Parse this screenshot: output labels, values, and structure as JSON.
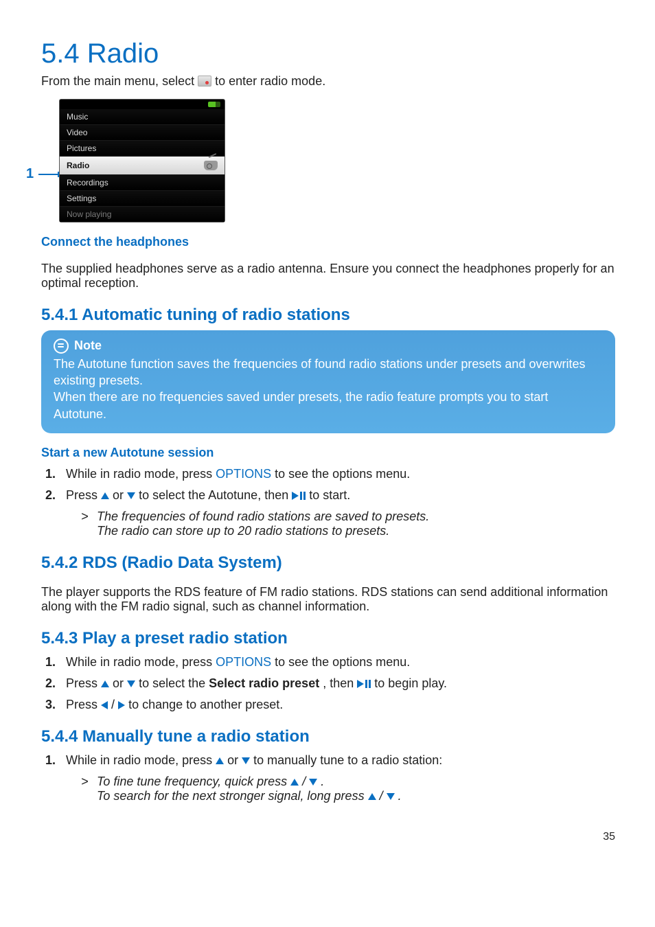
{
  "title": "5.4  Radio",
  "intro_before": "From the main menu, select ",
  "intro_after": " to enter radio mode.",
  "device": {
    "items": [
      "Music",
      "Video",
      "Pictures",
      "Radio",
      "Recordings",
      "Settings",
      "Now playing"
    ],
    "selected_index": 3,
    "callout_number": "1"
  },
  "h_connect": "Connect the headphones",
  "p_connect": "The supplied headphones serve as a radio antenna. Ensure you connect the headphones properly for an optimal reception.",
  "s541": {
    "heading": "5.4.1 Automatic tuning of radio stations",
    "note_label": "Note",
    "note_body1": "The Autotune function saves the frequencies of found radio stations under presets and overwrites existing presets.",
    "note_body2": "When there are no frequencies saved under presets, the radio feature prompts you to start Autotune.",
    "start_heading": "Start a new Autotune session",
    "step1_a": "While in radio mode, press ",
    "step1_options": "OPTIONS",
    "step1_b": " to see the options menu.",
    "step2_a": "Press ",
    "step2_b": " or ",
    "step2_c": " to select the Autotune, then ",
    "step2_d": " to start.",
    "result1": "The frequencies of found radio stations are saved to presets.",
    "result2": "The radio can store up to 20 radio stations to presets."
  },
  "s542": {
    "heading": "5.4.2 RDS (Radio Data System)",
    "body": "The player supports the RDS feature of FM radio stations. RDS stations can send additional information along with the FM radio signal, such as channel information."
  },
  "s543": {
    "heading": "5.4.3 Play a preset radio station",
    "step1_a": "While in radio mode, press ",
    "step1_options": "OPTIONS",
    "step1_b": " to see the options menu.",
    "step2_a": "Press ",
    "step2_b": " or ",
    "step2_c": " to select the ",
    "step2_bold": "Select radio preset",
    "step2_d": ", then ",
    "step2_e": " to begin play.",
    "step3_a": "Press ",
    "step3_b": "/",
    "step3_c": " to change to another preset."
  },
  "s544": {
    "heading": "5.4.4 Manually tune a radio station",
    "step1_a": "While in radio mode, press ",
    "step1_b": " or ",
    "step1_c": " to manually tune to a radio station:",
    "result1_a": "To fine tune frequency, quick press ",
    "result1_b": "/",
    "result1_c": ".",
    "result2_a": "To search for the next stronger signal, long press ",
    "result2_b": "/",
    "result2_c": "."
  },
  "page_number": "35"
}
